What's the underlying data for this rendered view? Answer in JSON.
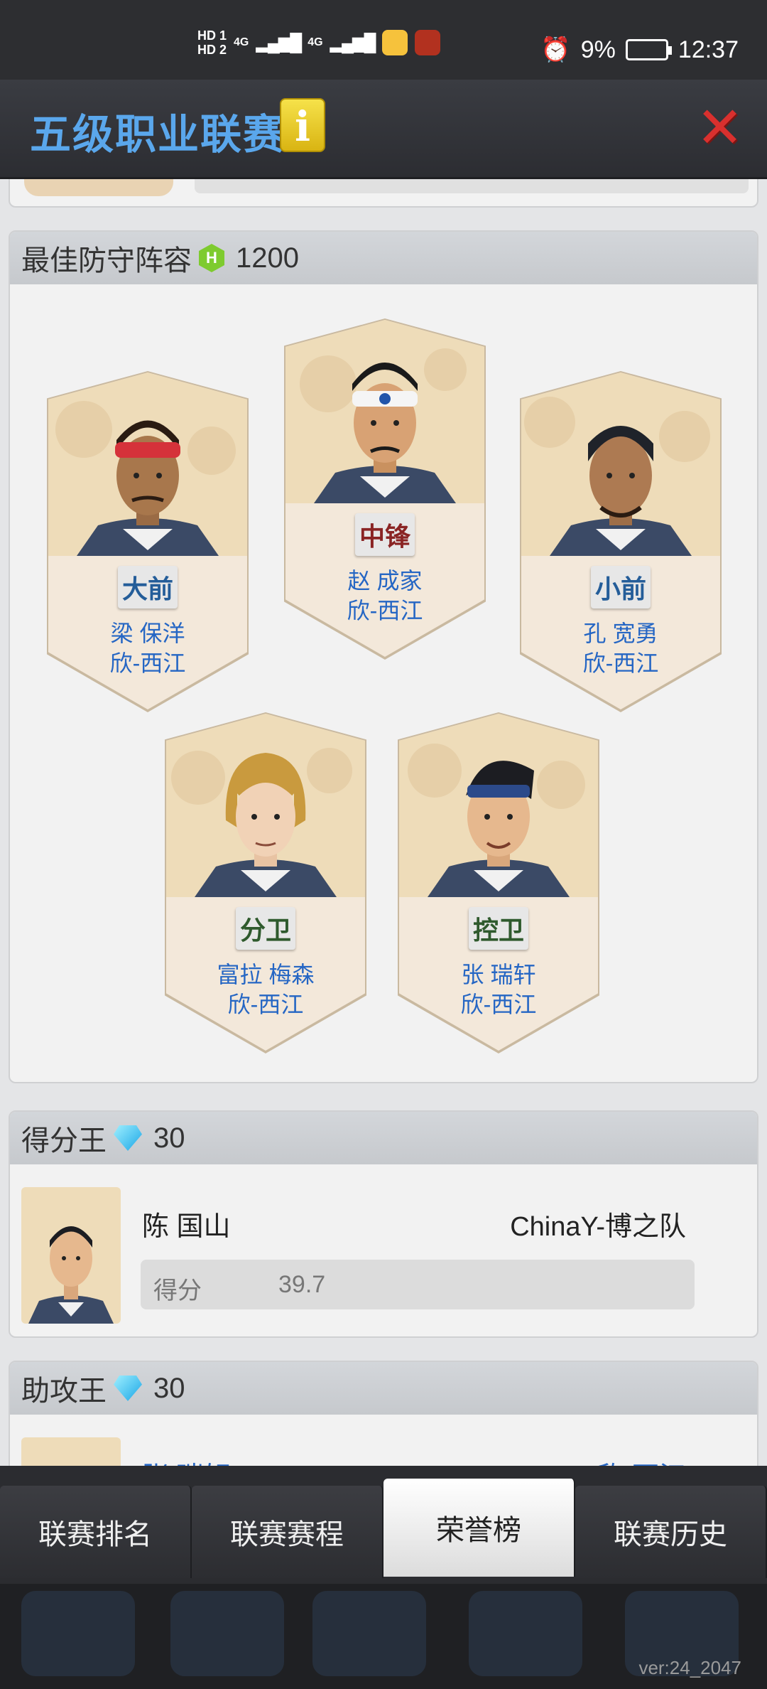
{
  "status_bar": {
    "sim1": "HD 1",
    "sim2": "HD 2",
    "net1": "4G",
    "net2": "4G",
    "battery": "9%",
    "time": "12:37"
  },
  "header": {
    "title": "五级职业联赛",
    "info_label": "i",
    "close_label": "✕"
  },
  "defense": {
    "title": "最佳防守阵容",
    "reward": "1200",
    "cards": [
      {
        "position": "大前",
        "name": "梁 保洋",
        "team": "欣-西江"
      },
      {
        "position": "中锋",
        "name": "赵 成家",
        "team": "欣-西江"
      },
      {
        "position": "小前",
        "name": "孔 宽勇",
        "team": "欣-西江"
      },
      {
        "position": "分卫",
        "name": "富拉 梅森",
        "team": "欣-西江"
      },
      {
        "position": "控卫",
        "name": "张 瑞轩",
        "team": "欣-西江"
      }
    ]
  },
  "scoring": {
    "title": "得分王",
    "reward": "30",
    "player": "陈 国山",
    "team": "ChinaY-博之队",
    "stat_label": "得分",
    "stat_value": "39.7"
  },
  "assists": {
    "title": "助攻王",
    "reward": "30",
    "player": "张 瑞轩",
    "team": "欣-西江"
  },
  "tabs": [
    {
      "label": "联赛排名",
      "active": false
    },
    {
      "label": "联赛赛程",
      "active": false
    },
    {
      "label": "荣誉榜",
      "active": true
    },
    {
      "label": "联赛历史",
      "active": false
    }
  ],
  "version": "ver:24_2047",
  "colors": {
    "title_blue": "#5aa7ec",
    "name_blue": "#2566c4",
    "close_red": "#d9302e",
    "card_bg": "#f3e8da"
  }
}
